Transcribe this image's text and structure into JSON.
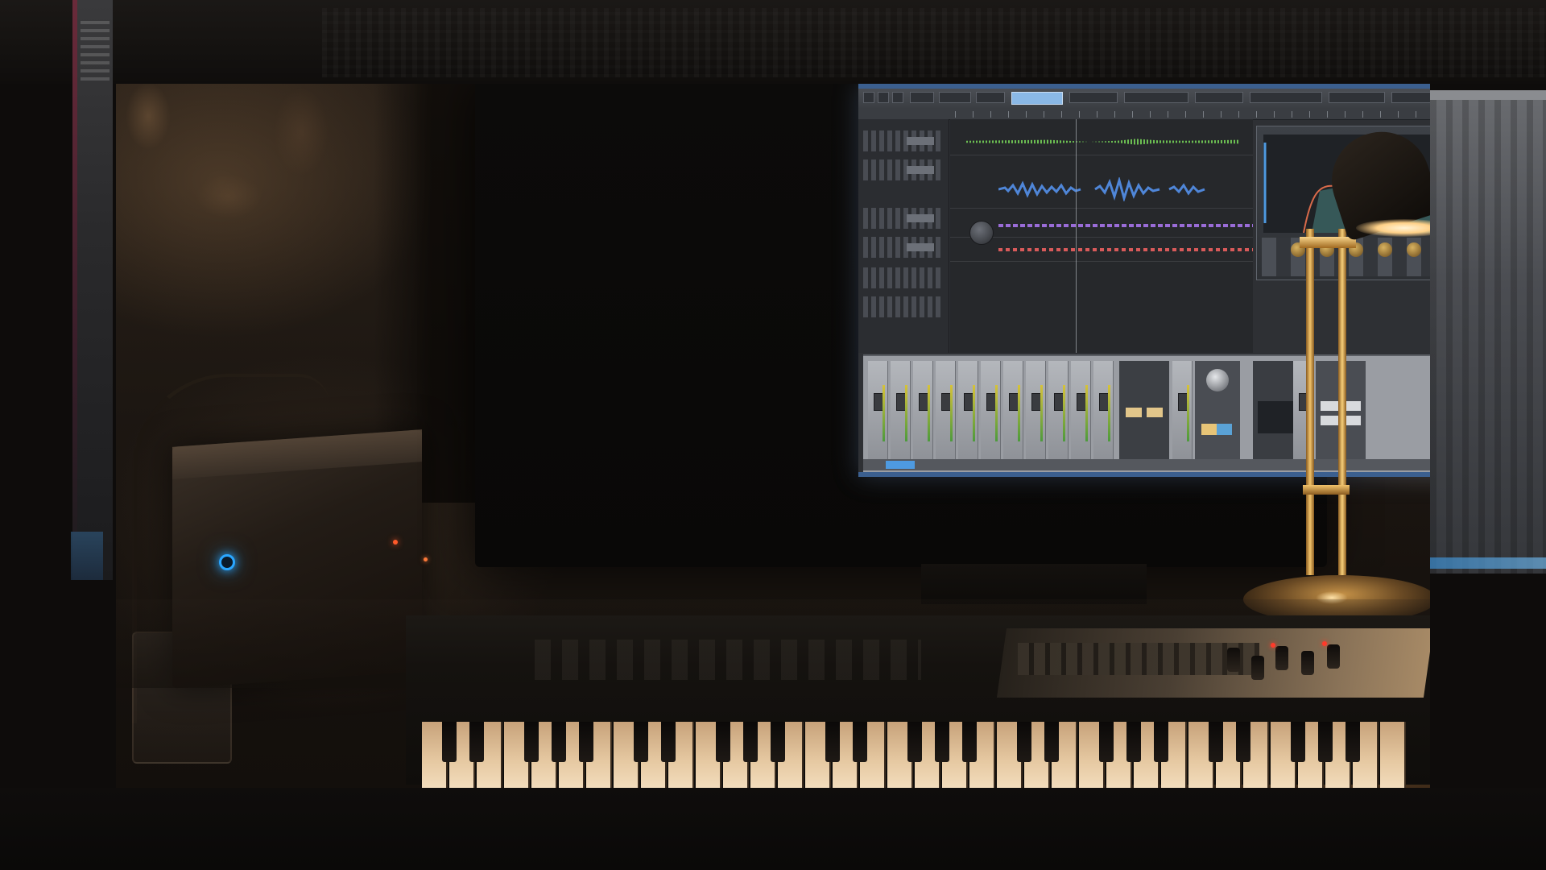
{
  "scene": {
    "description_tag": "music-studio-photo",
    "daw": {
      "window": "daw-software",
      "tracks": 8,
      "accent_color": "#3b5f8f",
      "wave_colors": [
        "#6cbf52",
        "#4f86d8",
        "#9a6cd8",
        "#d85a5a"
      ]
    },
    "power_led_color": "#2aa6ff",
    "lamp_color": "#f2c46c"
  }
}
